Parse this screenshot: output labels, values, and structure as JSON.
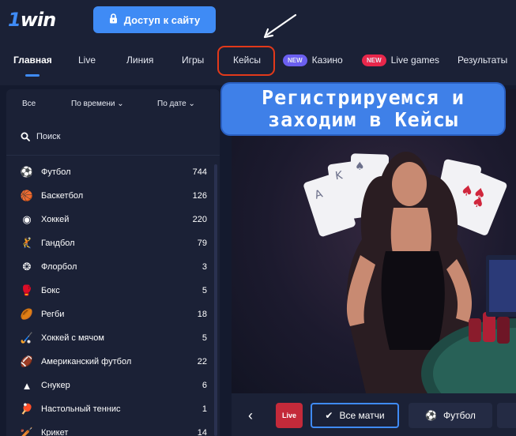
{
  "header": {
    "logo_one": "1",
    "logo_win": "win",
    "access_button": "Доступ к сайту"
  },
  "nav": {
    "items": [
      "Главная",
      "Live",
      "Линия",
      "Игры",
      "Кейсы",
      "Казино",
      "Live games",
      "Результаты"
    ],
    "badge_new": "NEW"
  },
  "sidebar": {
    "filters": [
      "Все",
      "По времени",
      "По дате"
    ],
    "search_label": "Поиск",
    "sports": [
      {
        "name": "Футбол",
        "count": "744",
        "icon": "soccer-ball-icon"
      },
      {
        "name": "Баскетбол",
        "count": "126",
        "icon": "basketball-icon"
      },
      {
        "name": "Хоккей",
        "count": "220",
        "icon": "hockey-puck-icon"
      },
      {
        "name": "Гандбол",
        "count": "79",
        "icon": "handball-icon"
      },
      {
        "name": "Флорбол",
        "count": "3",
        "icon": "floorball-icon"
      },
      {
        "name": "Бокс",
        "count": "5",
        "icon": "boxing-glove-icon"
      },
      {
        "name": "Регби",
        "count": "18",
        "icon": "rugby-ball-icon"
      },
      {
        "name": "Хоккей с мячом",
        "count": "5",
        "icon": "bandy-stick-icon"
      },
      {
        "name": "Американский футбол",
        "count": "22",
        "icon": "american-football-icon"
      },
      {
        "name": "Снукер",
        "count": "6",
        "icon": "snooker-icon"
      },
      {
        "name": "Настольный теннис",
        "count": "1",
        "icon": "table-tennis-icon"
      },
      {
        "name": "Крикет",
        "count": "14",
        "icon": "cricket-icon"
      }
    ]
  },
  "banner": {
    "caption_line1": "Регистрируемся и",
    "caption_line2": "заходим в Кейсы"
  },
  "bottom": {
    "live_label": "Live",
    "all_matches": "Все матчи",
    "football": "Футбол"
  },
  "colors": {
    "accent": "#3f8bf5",
    "header_bg": "#1b2136",
    "page_bg": "#141a2e",
    "new_badge_purple": "#6b5ff0",
    "new_badge_red": "#e8274b",
    "highlight_red": "#e2391a"
  }
}
